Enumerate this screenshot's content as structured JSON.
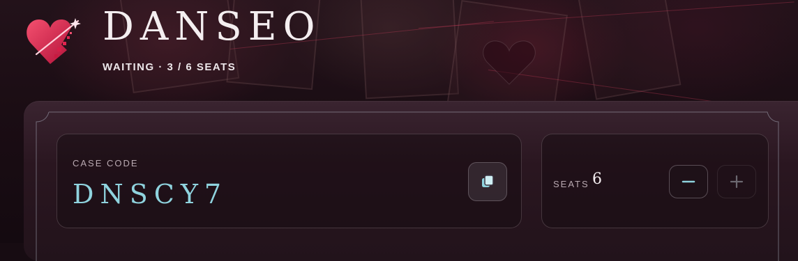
{
  "app": {
    "title": "DANSEO",
    "status": "WAITING · 3 / 6 SEATS",
    "logo_icon": "broken-heart-logo-icon"
  },
  "case": {
    "label": "CASE CODE",
    "code": "DNSCY7",
    "copy_icon": "copy-icon"
  },
  "seats": {
    "label": "SEATS",
    "value": "6",
    "decrement_icon": "minus-icon",
    "increment_icon": "plus-icon"
  },
  "colors": {
    "accent_cyan": "#8fd3de",
    "brand_pink": "#e0254f",
    "panel": "#2a1620"
  }
}
